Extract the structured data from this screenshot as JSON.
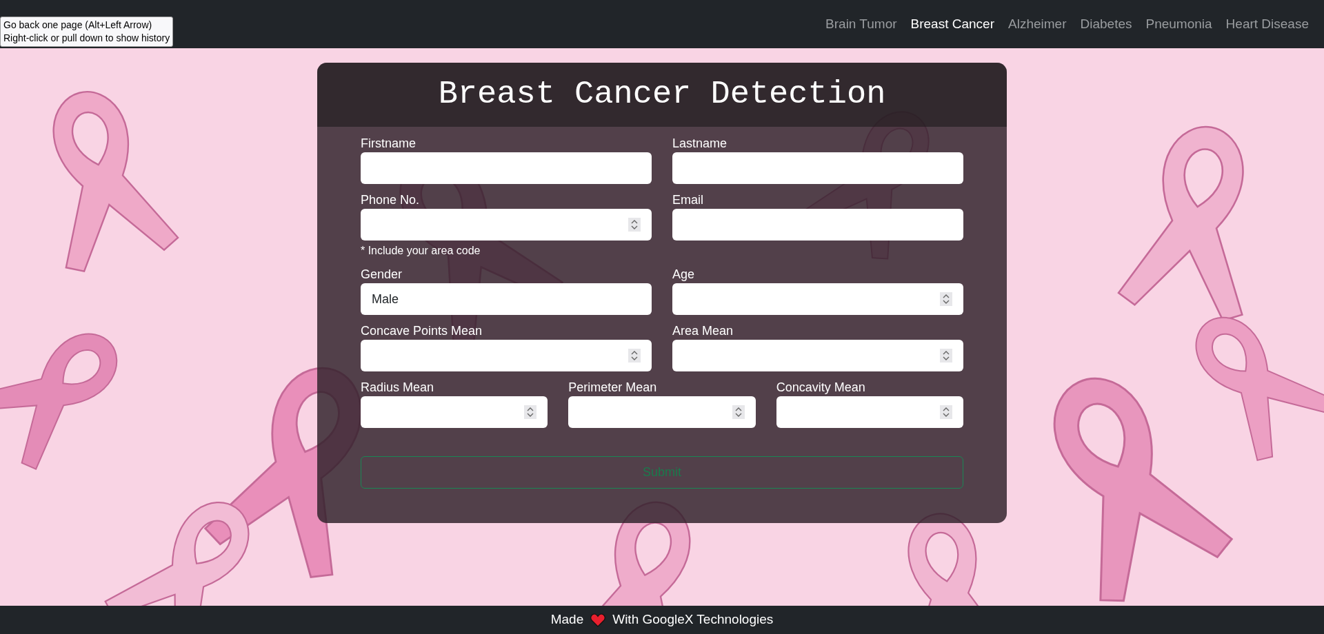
{
  "tooltip": {
    "lines": [
      "Go back one page (Alt+Left Arrow)",
      "Right-click or pull down to show history"
    ]
  },
  "nav": {
    "items": [
      {
        "label": "Brain Tumor",
        "selected": false
      },
      {
        "label": "Breast Cancer",
        "selected": true
      },
      {
        "label": "Alzheimer",
        "selected": false
      },
      {
        "label": "Diabetes",
        "selected": false
      },
      {
        "label": "Pneumonia",
        "selected": false
      },
      {
        "label": "Heart Disease",
        "selected": false
      }
    ]
  },
  "form": {
    "title": "Breast Cancer Detection",
    "rows": [
      {
        "fields": [
          {
            "label": "Firstname",
            "kind": "text"
          },
          {
            "label": "Lastname",
            "kind": "text"
          }
        ]
      },
      {
        "fields": [
          {
            "label": "Phone No.",
            "kind": "number",
            "hint": "* Include your area code"
          },
          {
            "label": "Email",
            "kind": "text"
          }
        ]
      },
      {
        "fields": [
          {
            "label": "Gender",
            "kind": "text",
            "value": "Male"
          },
          {
            "label": "Age",
            "kind": "number"
          }
        ]
      },
      {
        "fields": [
          {
            "label": "Concave Points Mean",
            "kind": "number"
          },
          {
            "label": "Area Mean",
            "kind": "number"
          }
        ]
      },
      {
        "fields": [
          {
            "label": "Radius Mean",
            "kind": "number"
          },
          {
            "label": "Perimeter Mean",
            "kind": "number"
          },
          {
            "label": "Concavity Mean",
            "kind": "number"
          }
        ]
      }
    ],
    "submit": "Submit"
  },
  "footer": {
    "before": "Made",
    "after": "With GoogleX Technologies"
  }
}
